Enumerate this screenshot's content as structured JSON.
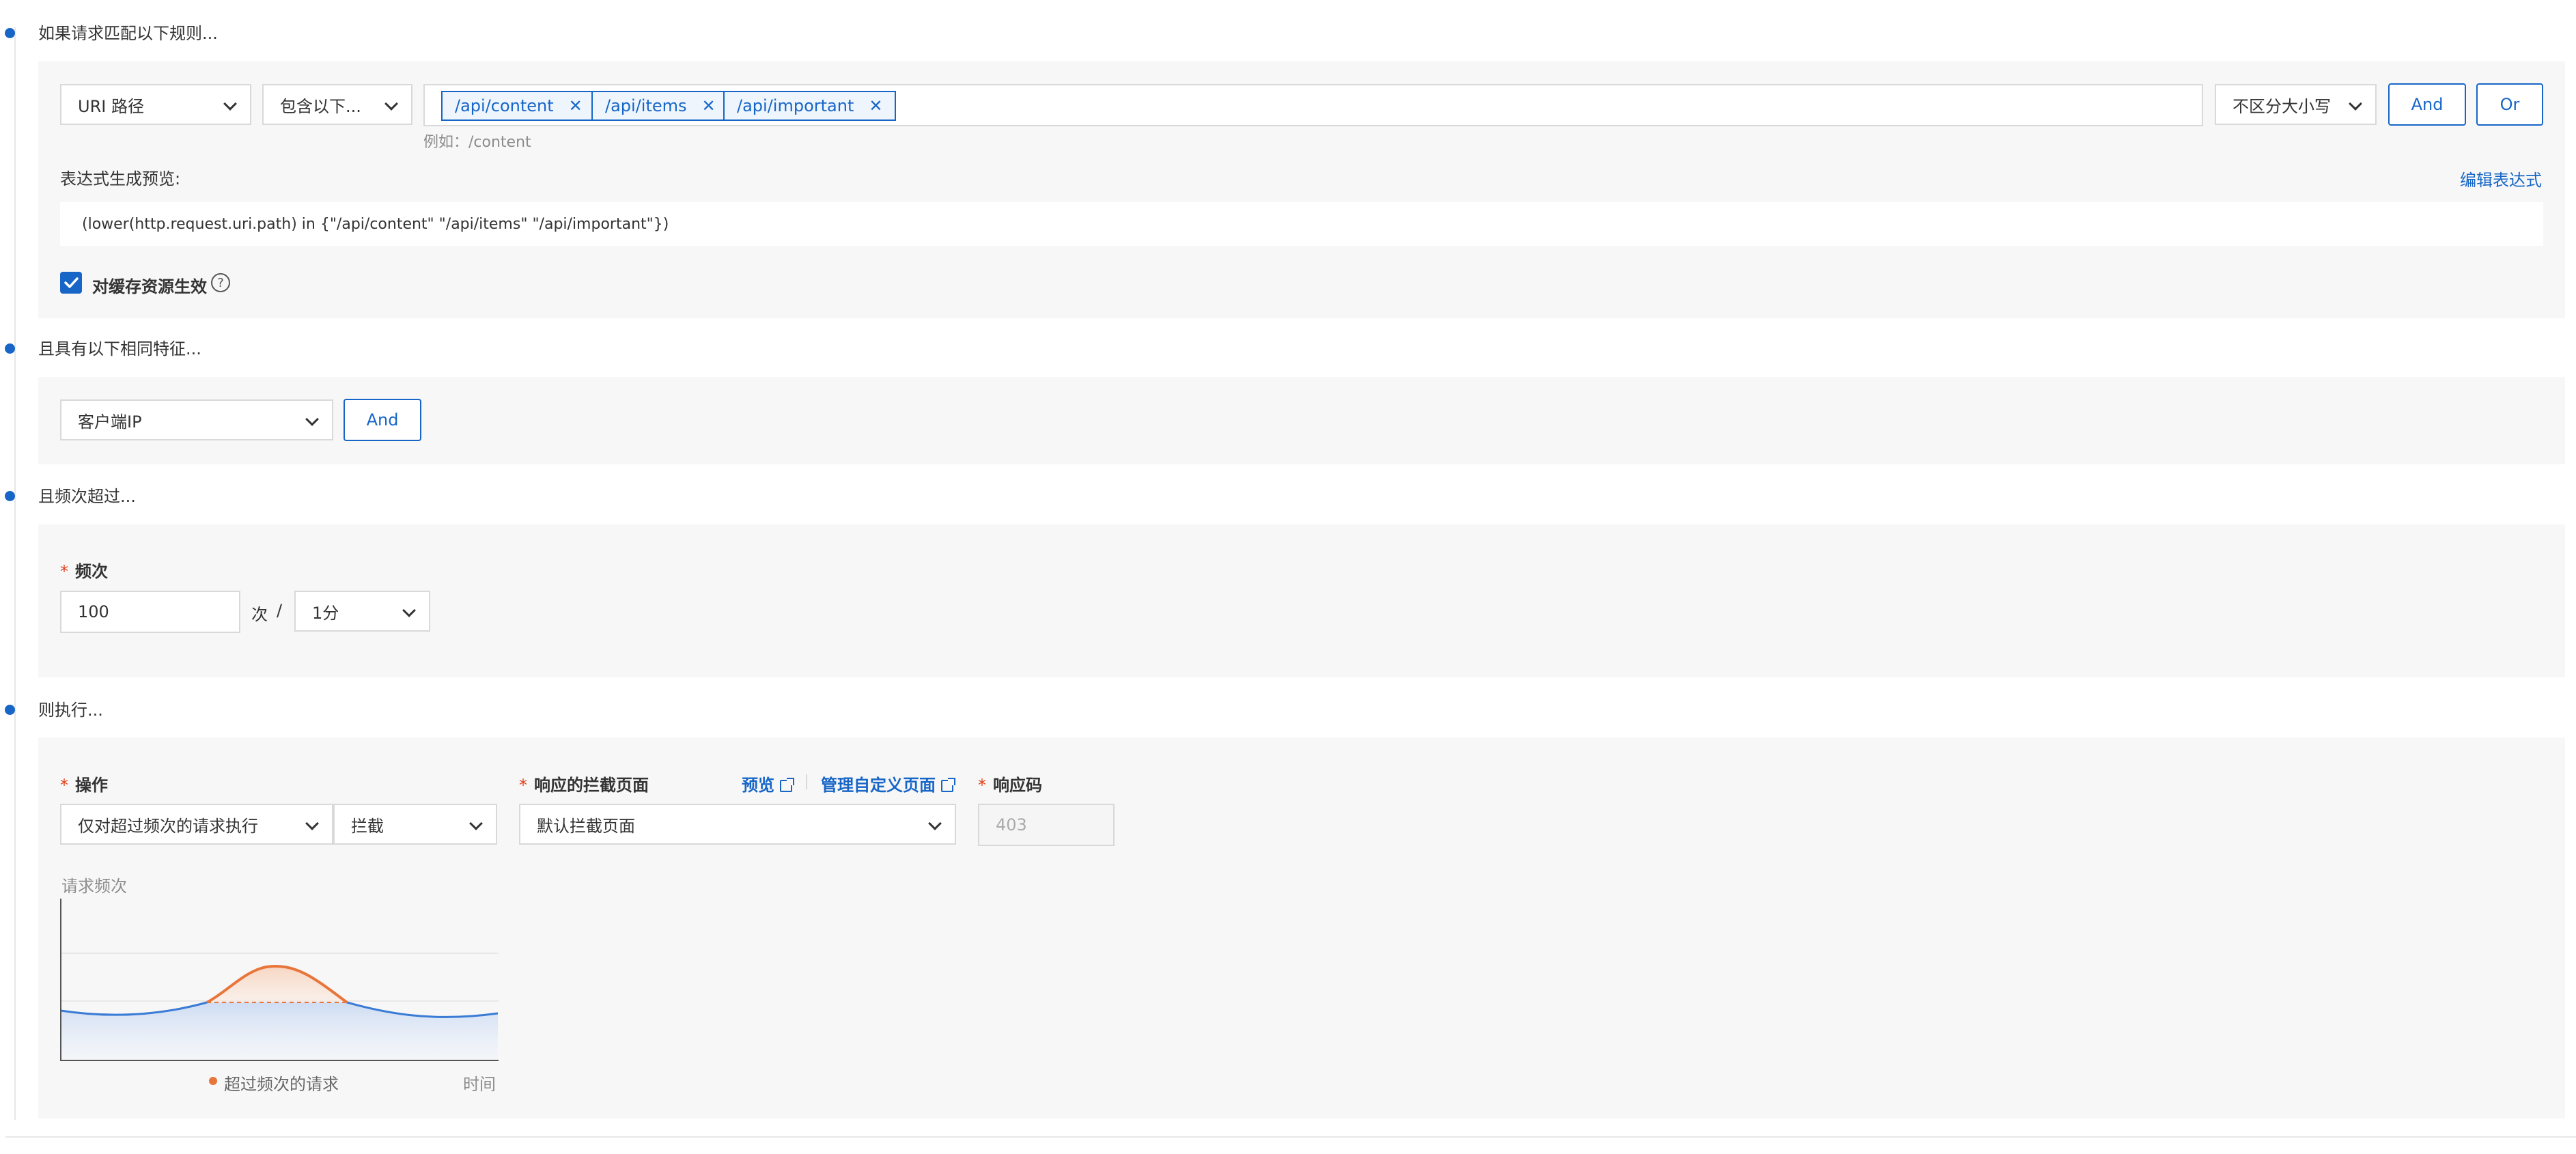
{
  "colors": {
    "accent": "#1766c7",
    "panel_bg": "#f7f7f7",
    "required": "#e0401a",
    "chart_orange": "#e8753a",
    "chart_blue": "#3a7bd5"
  },
  "section1": {
    "title": "如果请求匹配以下规则...",
    "field_select": "URI 路径",
    "operator_select": "包含以下...",
    "tags": [
      "/api/content",
      "/api/items",
      "/api/important"
    ],
    "case_select": "不区分大小写",
    "and_label": "And",
    "or_label": "Or",
    "example_hint": "例如：/content",
    "preview_label": "表达式生成预览:",
    "edit_expression": "编辑表达式",
    "expression": "(lower(http.request.uri.path) in {\"/api/content\" \"/api/items\" \"/api/important\"})",
    "cache_label": "对缓存资源生效",
    "cache_checked": true
  },
  "section2": {
    "title": "且具有以下相同特征...",
    "feature_select": "客户端IP",
    "and_label": "And"
  },
  "section3": {
    "title": "且频次超过...",
    "freq_label": "频次",
    "freq_value": "100",
    "unit_times": "次",
    "slash": "/",
    "period_select": "1分"
  },
  "section4": {
    "title": "则执行...",
    "op_label": "操作",
    "op_mode_select": "仅对超过频次的请求执行",
    "op_action_select": "拦截",
    "block_page_label": "响应的拦截页面",
    "preview_link": "预览",
    "manage_link": "管理自定义页面",
    "block_page_select": "默认拦截页面",
    "resp_code_label": "响应码",
    "resp_code_value": "403"
  },
  "chart_data": {
    "type": "area",
    "ylabel": "请求频次",
    "xlabel": "时间",
    "legend": "超过频次的请求",
    "grid": true
  }
}
